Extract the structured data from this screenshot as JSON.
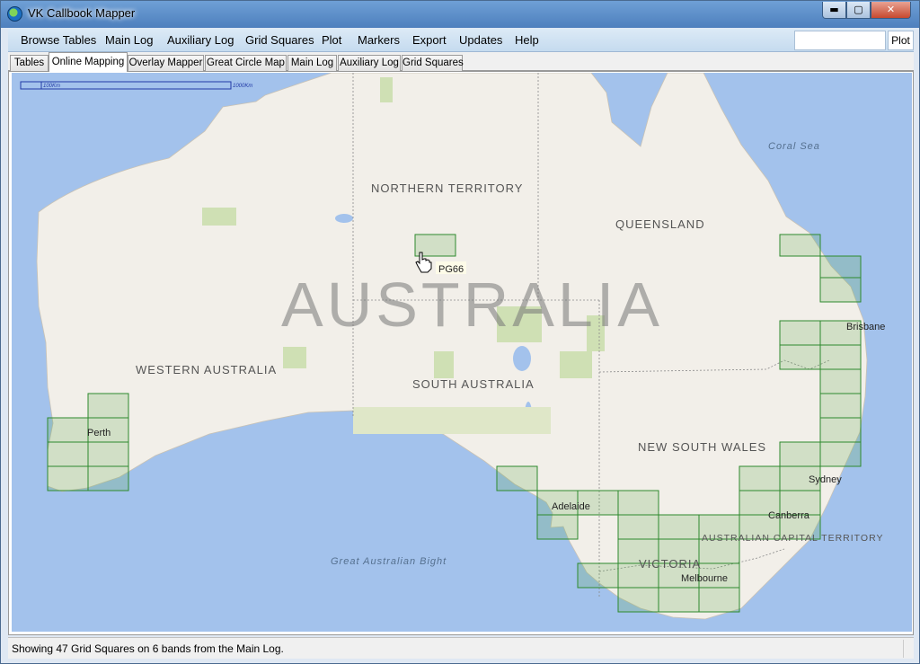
{
  "window": {
    "title": "VK Callbook Mapper",
    "controls": {
      "minimize": "▬",
      "maximize": "▢",
      "close": "✕"
    }
  },
  "menu": {
    "items": [
      "Browse Tables",
      "Main Log",
      "Auxiliary Log",
      "Grid Squares",
      "Plot",
      "Markers",
      "Export",
      "Updates",
      "Help"
    ],
    "plot_input_value": "",
    "plot_button": "Plot"
  },
  "tabs": {
    "items": [
      "Tables",
      "Online Mapping",
      "Overlay Mapper",
      "Great Circle Map",
      "Main Log",
      "Auxiliary Log",
      "Grid Squares"
    ],
    "active": "Online Mapping"
  },
  "map": {
    "watermark": "AUSTRALIA",
    "scale": {
      "small": "100Km",
      "large": "1000Km"
    },
    "states": [
      "NORTHERN TERRITORY",
      "QUEENSLAND",
      "WESTERN AUSTRALIA",
      "SOUTH AUSTRALIA",
      "NEW SOUTH WALES",
      "VICTORIA",
      "AUSTRALIAN CAPITAL TERRITORY"
    ],
    "seas": [
      "Coral Sea",
      "Great Australian Bight"
    ],
    "cities": [
      "Perth",
      "Adelaide",
      "Brisbane",
      "Sydney",
      "Canberra",
      "Melbourne"
    ],
    "hover_grid_label": "PG66",
    "colors": {
      "ocean": "#a3c2ec",
      "land": "#f2efe9",
      "grid_stroke": "#2d8a2d",
      "park": "#cfe0b4"
    }
  },
  "status": {
    "text": "Showing 47 Grid Squares on 6 bands from the Main Log."
  }
}
